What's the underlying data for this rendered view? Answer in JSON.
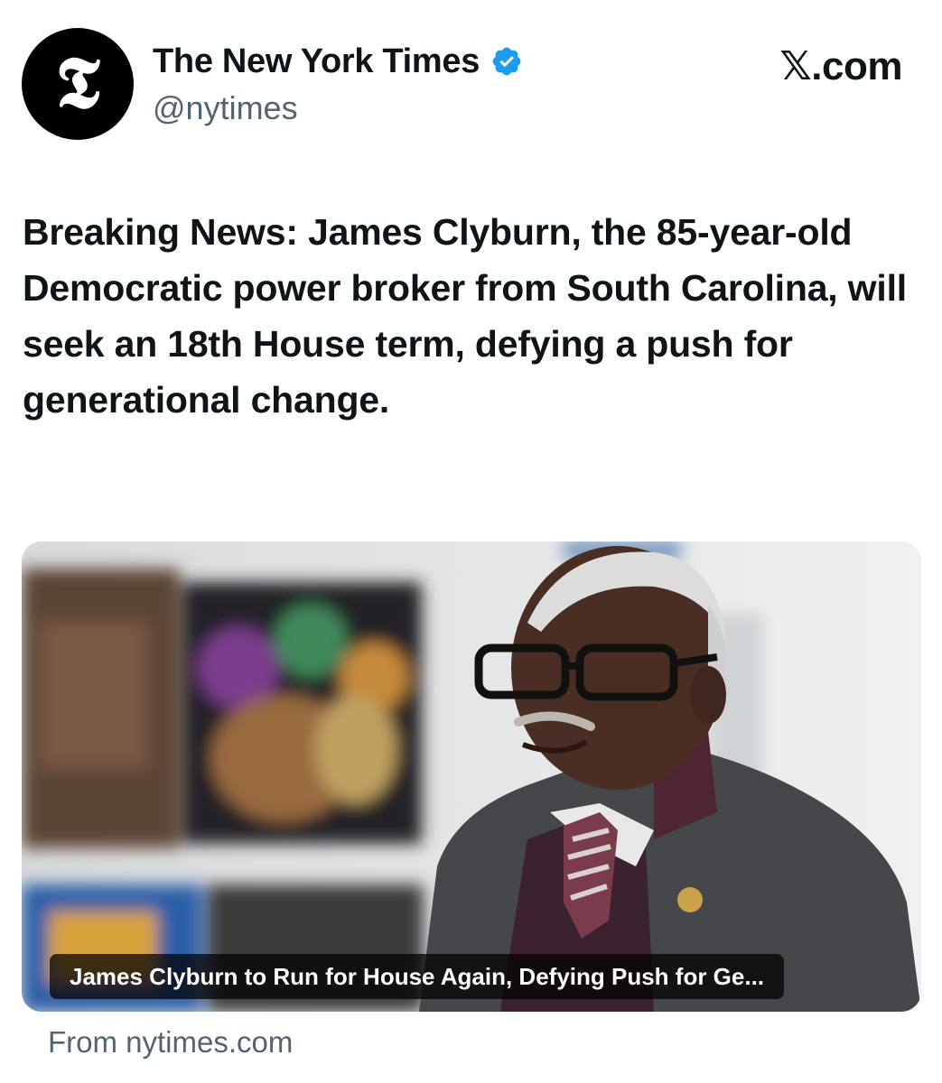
{
  "account": {
    "avatar_icon": "nyt-logo-icon",
    "avatar_glyph": "𝕿",
    "display_name": "The New York Times",
    "verified_icon": "verified-badge-icon",
    "handle": "@nytimes"
  },
  "site_label": "𝕏.com",
  "tweet": {
    "text": "Breaking News: James Clyburn, the 85-year-old Democratic power broker from South Carolina, will seek an 18th House term, defying a push for generational change."
  },
  "link_card": {
    "image_icon": "news-photo",
    "caption": "James Clyburn to Run for House Again, Defying Push for Ge...",
    "source": "From nytimes.com"
  },
  "colors": {
    "text": "#0f1419",
    "secondary": "#536471",
    "verified": "#1d9bf0"
  }
}
